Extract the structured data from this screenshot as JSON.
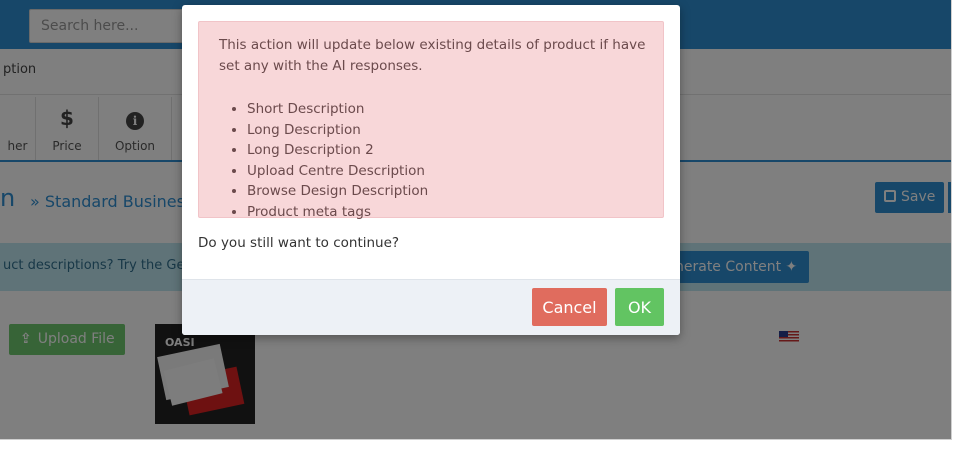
{
  "header": {
    "search_placeholder": "Search here..."
  },
  "breadcrumb": {
    "partial_text": "ption"
  },
  "tabs": [
    {
      "label": "her",
      "icon": "other-icon"
    },
    {
      "label": "Price",
      "icon": "dollar-icon"
    },
    {
      "label": "Option",
      "icon": "info-icon"
    }
  ],
  "product": {
    "heading_fragment": "n",
    "crumb_separator": "»",
    "crumb_text": "Standard Busines",
    "save_label": "Save"
  },
  "ai_banner": {
    "text_fragment": "uct descriptions? Try the Ger",
    "generate_label": "nerate Content"
  },
  "upload": {
    "label": "Upload File",
    "thumb_text": "OASI"
  },
  "modal": {
    "message": "This action will update below existing details of product if have set any with the AI responses.",
    "items": [
      "Short Description",
      "Long Description",
      "Long Description 2",
      "Upload Centre Description",
      "Browse Design Description",
      "Product meta tags"
    ],
    "confirm_text": "Do you still want to continue?",
    "cancel_label": "Cancel",
    "ok_label": "OK"
  },
  "colors": {
    "primary": "#2f8fd3",
    "alert_bg": "#f8d7d9",
    "cancel": "#e06c5e",
    "ok": "#62c462",
    "upload": "#6fc86f"
  }
}
